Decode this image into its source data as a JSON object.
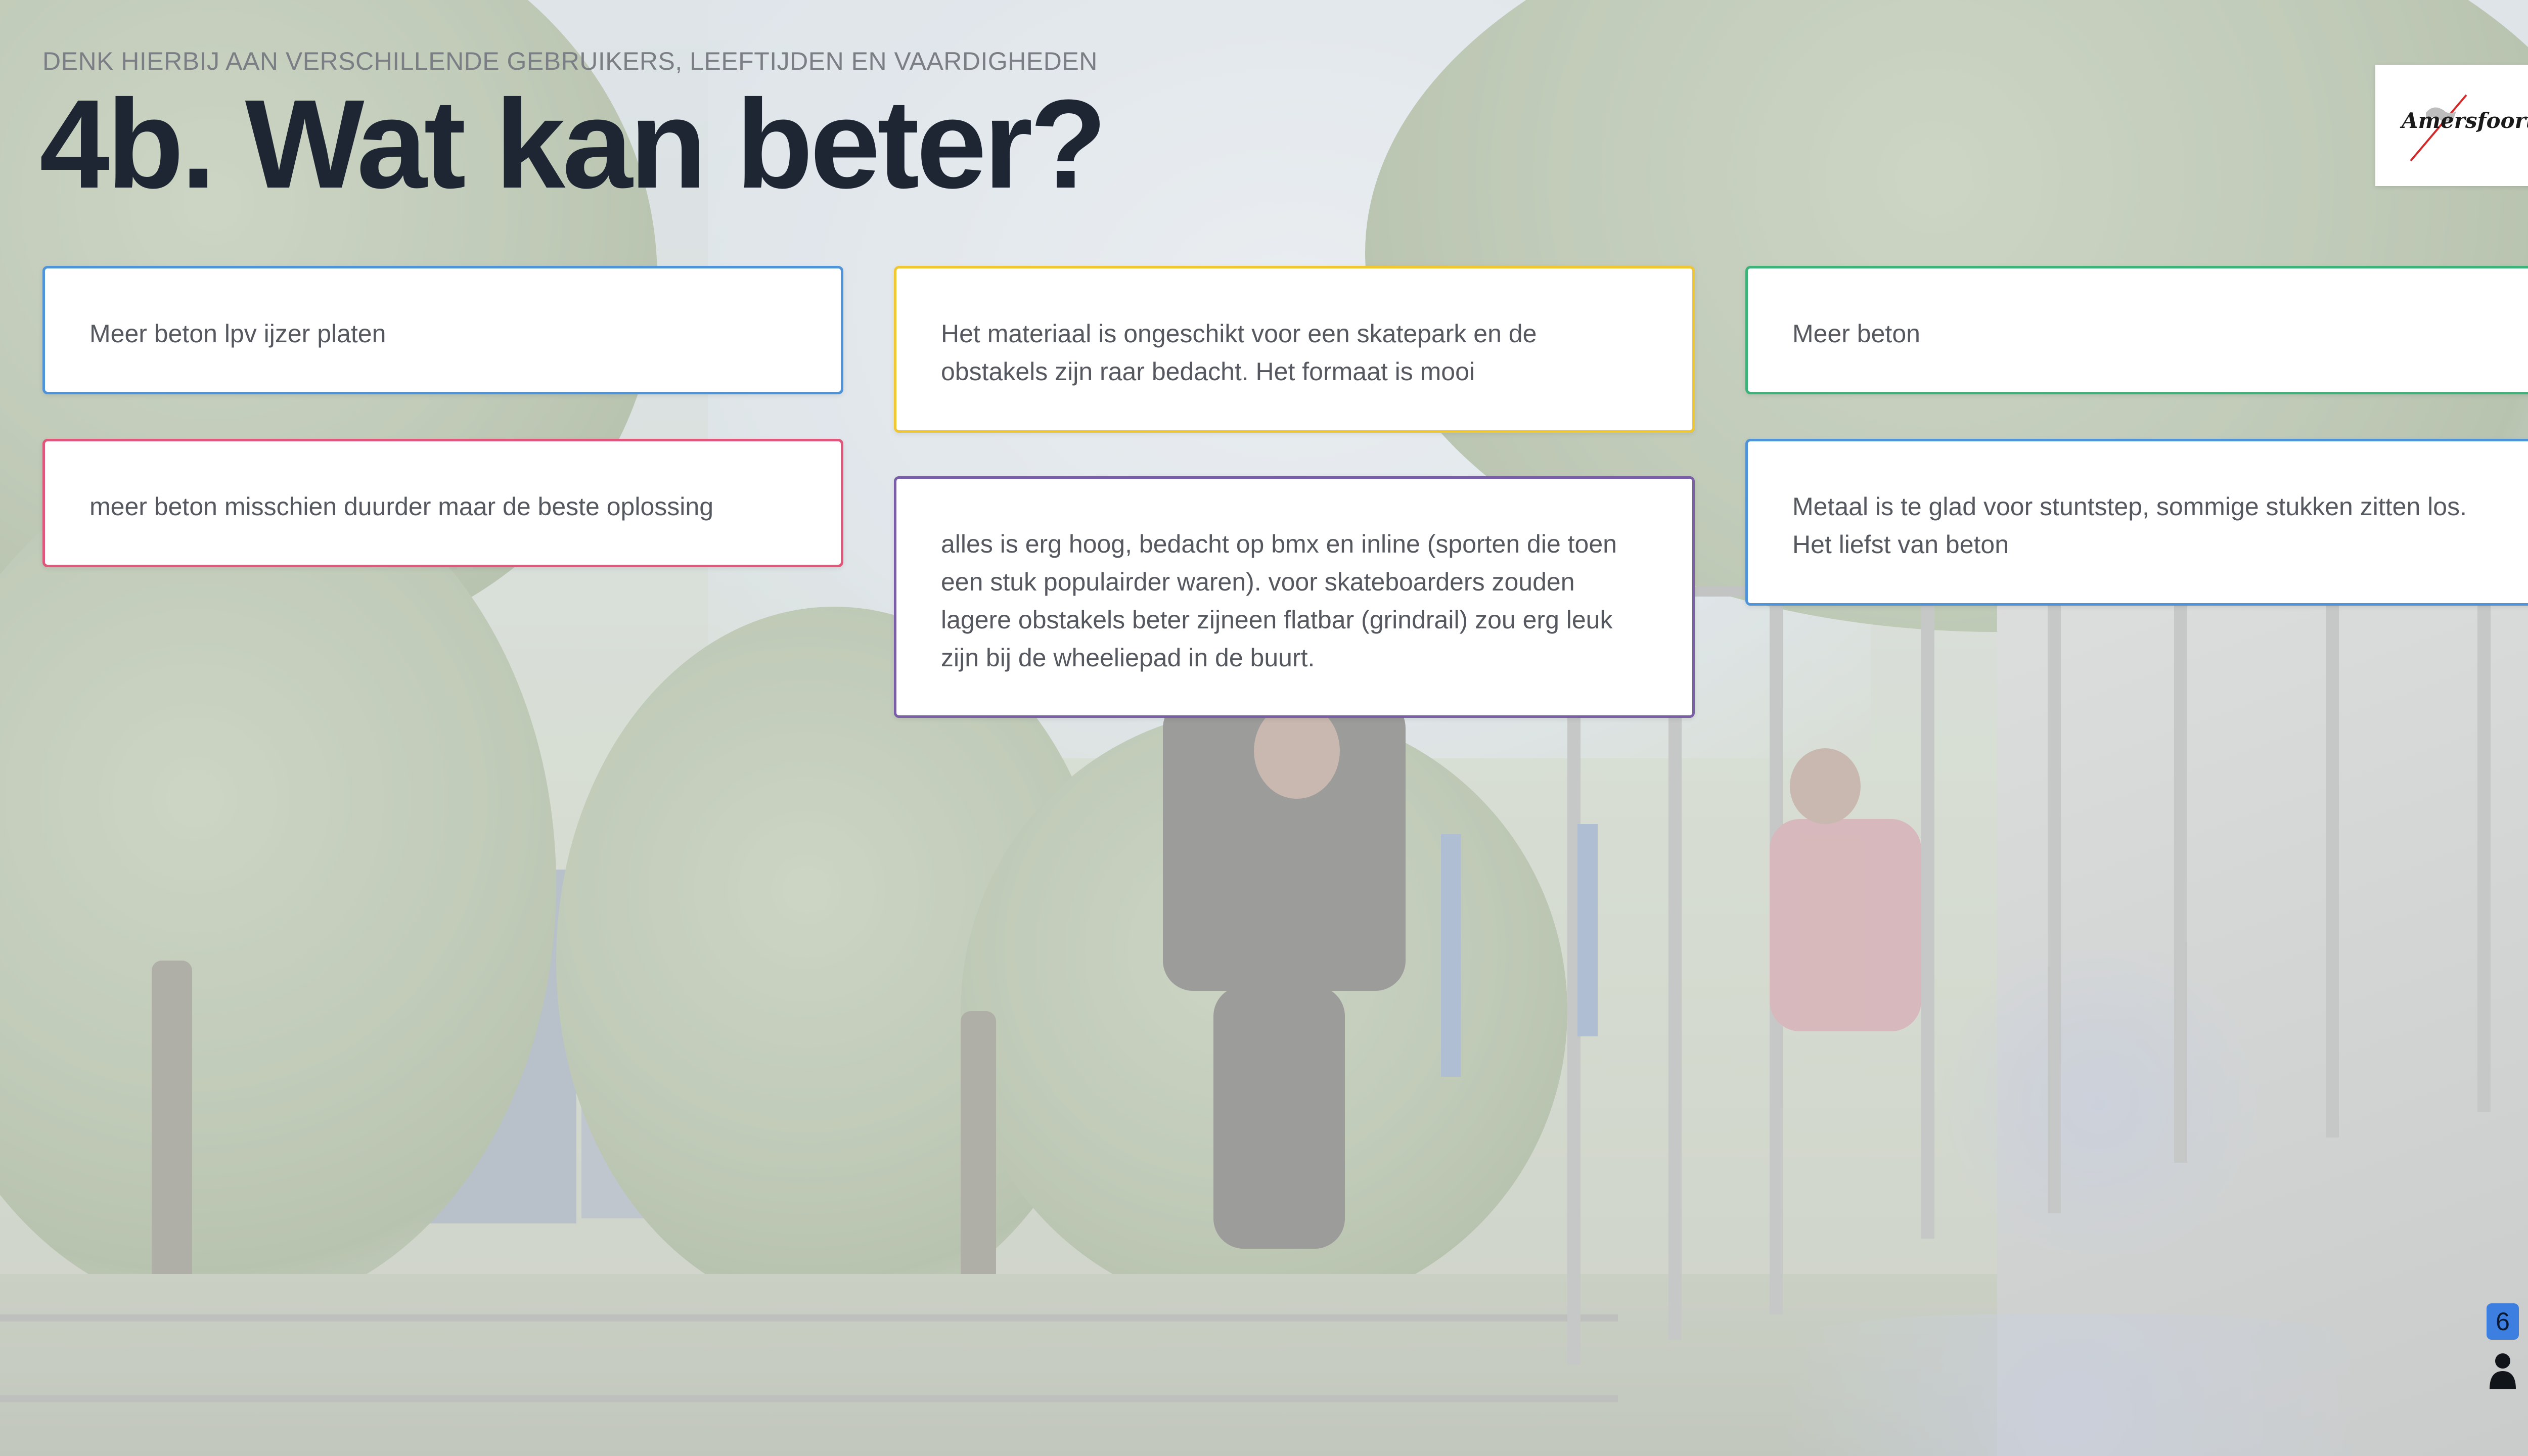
{
  "slide": {
    "subtitle": "DENK HIERBIJ AAN VERSCHILLENDE GEBRUIKERS, LEEFTIJDEN EN VAARDIGHEDEN",
    "title": "4b. Wat kan beter?",
    "logo_text": "Amersfoort"
  },
  "responses": [
    {
      "text": "Meer beton lpv ijzer platen",
      "color": "#4f93d8"
    },
    {
      "text": "meer beton misschien duurder maar de beste oplossing",
      "color": "#e0577c"
    },
    {
      "text": "Het materiaal is ongeschikt voor een skatepark en de obstakels zijn raar bedacht. Het formaat is mooi",
      "color": "#f0c733"
    },
    {
      "text": "alles is erg hoog, bedacht op bmx en inline (sporten die toen een stuk populairder waren). voor skateboarders zouden lagere obstakels beter zijneen flatbar (grindrail) zou erg leuk zijn bij de wheeliepad in de buurt.",
      "color": "#7a5ea8"
    },
    {
      "text": "Meer beton",
      "color": "#3db37a"
    },
    {
      "text": "Metaal is te glad voor stuntstep, sommige stukken zitten los. Het liefst van beton",
      "color": "#4f93d8"
    }
  ],
  "participants": {
    "count": "6",
    "icon": "person-icon"
  },
  "background": {
    "icon": "skatepark-photo"
  }
}
